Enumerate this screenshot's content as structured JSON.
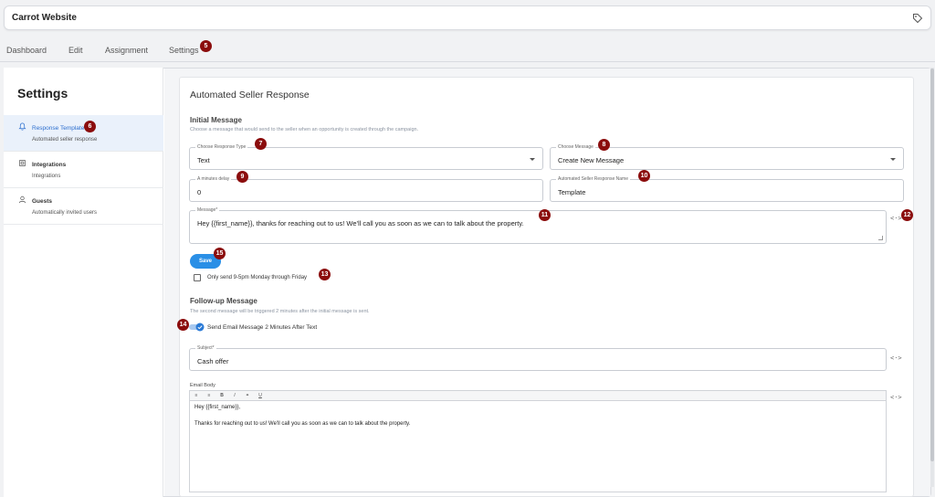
{
  "app": {
    "title": "Carrot Website",
    "icon": "tag-icon"
  },
  "nav": {
    "tabs": [
      {
        "label": "Dashboard"
      },
      {
        "label": "Edit"
      },
      {
        "label": "Assignment"
      },
      {
        "label": "Settings",
        "badge": "5"
      }
    ]
  },
  "sidebar": {
    "heading": "Settings",
    "items": [
      {
        "label": "Response Template",
        "sub": "Automated seller response",
        "icon": "bell-icon",
        "active": true,
        "badge": "6"
      },
      {
        "label": "Integrations",
        "sub": "Integrations",
        "icon": "integrations-icon",
        "active": false
      },
      {
        "label": "Guests",
        "sub": "Automatically invited users",
        "icon": "user-icon",
        "active": false
      }
    ]
  },
  "main": {
    "title": "Automated Seller Response",
    "initial": {
      "title": "Initial Message",
      "desc": "Choose a message that would send to the seller when an opportunity is created through the campaign.",
      "response_type": {
        "label": "Choose Response Type",
        "value": "Text",
        "badge": "7"
      },
      "choose_message": {
        "label": "Choose Message",
        "value": "Create New Message",
        "badge": "8"
      },
      "delay": {
        "label": "A minutes delay",
        "value": "0",
        "badge": "9"
      },
      "response_name": {
        "label": "Automated Seller Response Name",
        "value": "Template",
        "badge": "10"
      },
      "message": {
        "label": "Message*",
        "value": "Hey {{first_name}}, thanks for reaching out to us! We'll call you as soon as we can to talk about the property.",
        "badge": "11"
      },
      "code_badge": "12",
      "code_icon": "<·>",
      "save_label": "Save",
      "save_badge": "15",
      "only_send_label": "Only send 9-5pm Monday through Friday",
      "only_send_badge": "13"
    },
    "followup": {
      "title": "Follow-up Message",
      "desc": "The second message will be triggered 2 minutes after the initial message is sent.",
      "toggle_label": "Send Email Message 2 Minutes After Text",
      "toggle_badge": "14",
      "subject": {
        "label": "Subject*",
        "value": "Cash offer"
      },
      "code_icon": "<·>",
      "email_body": {
        "label": "Email Body",
        "toolbar": [
          "≡",
          "≡",
          "B",
          "I",
          "⚭",
          "U"
        ],
        "lines": [
          "Hey {{first_name}},",
          "Thanks for reaching out to us! We'll call you as soon as we can to talk about the property."
        ]
      }
    }
  },
  "colors": {
    "accent": "#2a8fe6",
    "badge": "#8b0d0d",
    "active_bg": "#eaf1fb"
  }
}
